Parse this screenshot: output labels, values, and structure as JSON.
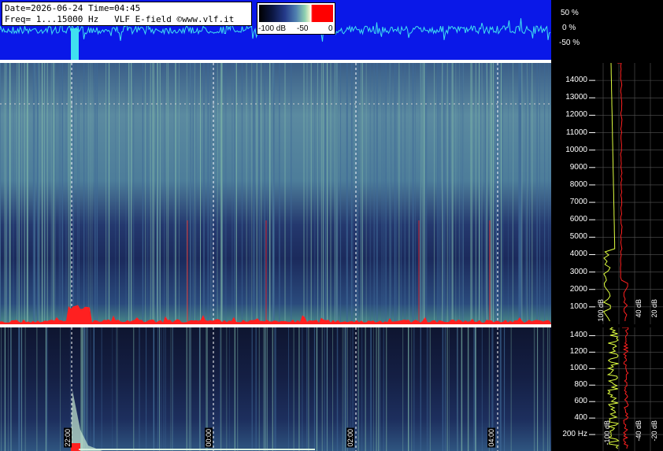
{
  "info": {
    "date_time": "Date=2026-06-24 Time=04:45",
    "freq_line": "Freq= 1...15000 Hz   VLF E-field ©www.vlf.it"
  },
  "colorbar": {
    "tick_left": "-100 dB",
    "tick_mid": "-50",
    "tick_right": "0"
  },
  "oscillogram": {
    "labels": [
      "50 %",
      "0 %",
      "-50 %"
    ]
  },
  "main_axis": {
    "ticks": [
      "14000",
      "13000",
      "12000",
      "11000",
      "10000",
      "9000",
      "8000",
      "7000",
      "6000",
      "5000",
      "4000",
      "3000",
      "2000",
      "1000"
    ]
  },
  "main_db_labels": [
    "100 dB",
    "40 dB",
    "20 dB"
  ],
  "zoom_axis": {
    "ticks": [
      "1400",
      "1200",
      "1000",
      "800",
      "600",
      "400",
      "200 Hz"
    ]
  },
  "zoom_db_labels": [
    "-100 dB",
    "-40 dB",
    "-20 dB"
  ],
  "time_labels": [
    "22:00",
    "00:00",
    "02:00",
    "04:00"
  ],
  "colors": {
    "osc_bg": "#0a18e8",
    "osc_trace": "#40e0f0",
    "red": "#ff2020",
    "yellow": "#e0ff40",
    "green": "#80ff60"
  }
}
